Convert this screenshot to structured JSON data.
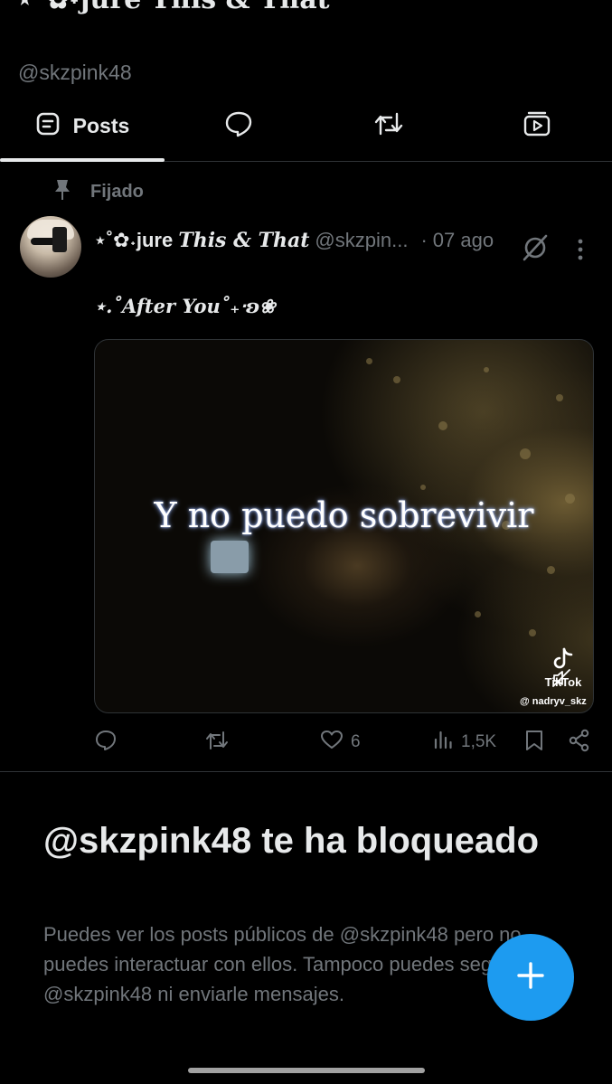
{
  "profile": {
    "display_name_top": "⋆˚✿˖jure This & That",
    "handle": "@skzpink48"
  },
  "tabs": [
    {
      "label": "Posts",
      "icon": "posts-icon",
      "active": true
    },
    {
      "label": "",
      "icon": "reply-bubble-icon"
    },
    {
      "label": "",
      "icon": "repost-icon"
    },
    {
      "label": "",
      "icon": "media-video-icon"
    }
  ],
  "pinned": {
    "label": "Fijado",
    "icon": "pin-icon"
  },
  "post": {
    "author_prefix": "⋆˚✿˖jure ",
    "author_italic": "This & That",
    "author_handle": "@skzpin...",
    "separator": "·",
    "date": "07 ago",
    "text": "⋆.˚After You˚₊‧ʚ❀",
    "media": {
      "caption": "Y no puedo sobrevivir",
      "tiktok_label": "TikTok",
      "tiktok_user": "@ nadryv_skz"
    },
    "actions": {
      "likes": "6",
      "views": "1,5K"
    }
  },
  "blocked": {
    "title": "@skzpink48 te ha bloqueado",
    "body": "Puedes ver los posts públicos de @skzpink48 pero no puedes interactuar con ellos. Tampoco puedes seguir a @skzpink48 ni enviarle mensajes."
  },
  "colors": {
    "background": "#000000",
    "text_primary": "#e7e9ea",
    "text_secondary": "#71767b",
    "accent": "#1d9bf0",
    "divider": "#2f3336"
  }
}
